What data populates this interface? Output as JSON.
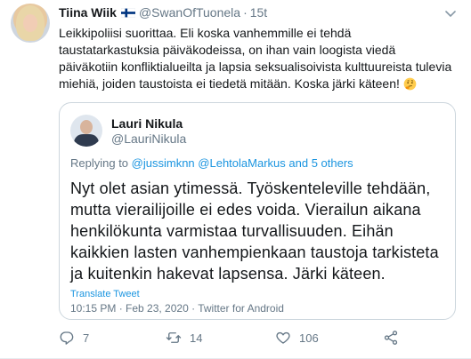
{
  "tweet": {
    "author_name": "Tiina Wiik",
    "author_handle": "@SwanOfTuonela",
    "separator": "·",
    "time": "15t",
    "text": "Leikkipoliisi suorittaa. Eli koska vanhemmille ei tehdä taustatarkastuksia päiväkodeissa, on ihan vain loogista viedä päiväkotiin konfliktialueilta ja lapsia seksualisoivista kulttuureista tulevia miehiä, joiden taustoista ei tiedetä mitään. Koska järki käteen!",
    "emoji_icon": "thinking-face-icon",
    "flag_icon": "finland-flag-icon"
  },
  "quoted": {
    "author_name": "Lauri Nikula",
    "author_handle": "@LauriNikula",
    "replying_prefix": "Replying to",
    "replying_1": "@jussimknn",
    "replying_2": "@LehtolaMarkus",
    "replying_suffix": "and 5 others",
    "text": "Nyt olet asian ytimessä. Työskenteleville tehdään, mutta vierailijoille ei edes voida. Vierailun aikana henkilökunta varmistaa turvallisuuden. Eihän kaikkien lasten vanhempienkaan taustoja tarkisteta ja kuitenkin hakevat lapsensa. Järki käteen.",
    "translate_label": "Translate Tweet",
    "timestamp": "10:15 PM · Feb 23, 2020",
    "meta_separator": "·",
    "source": "Twitter for Android"
  },
  "actions": {
    "reply_count": "7",
    "retweet_count": "14",
    "like_count": "106"
  },
  "colors": {
    "link": "#1b95e0",
    "secondary_text": "#657786",
    "border": "#ccd6dd"
  }
}
